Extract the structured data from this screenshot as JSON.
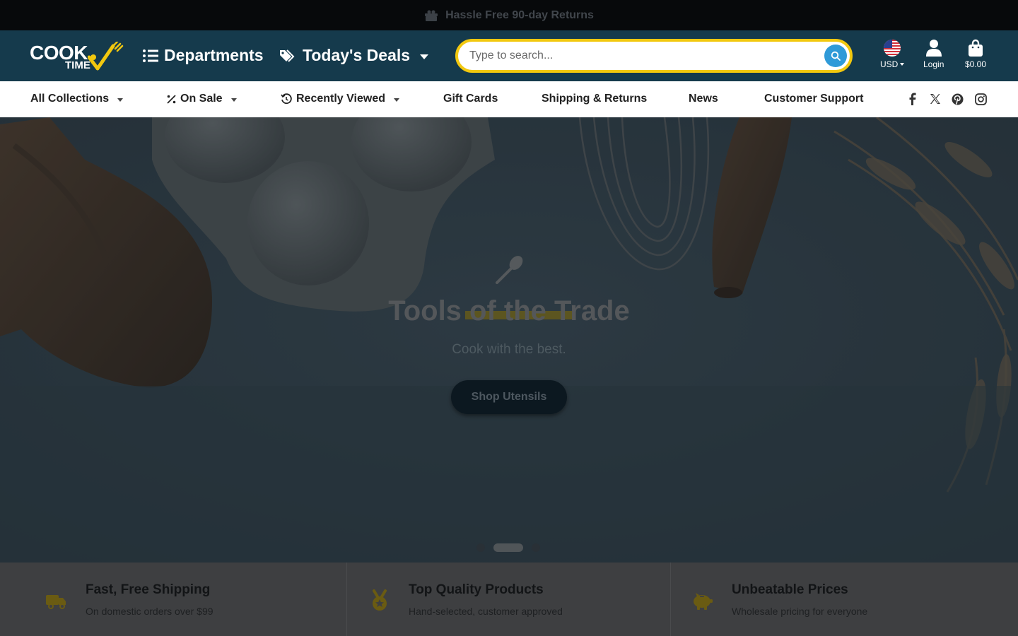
{
  "announcement": {
    "text": "Hassle Free 90-day Returns",
    "icon": "gift-box-icon"
  },
  "header": {
    "logo": {
      "word1": "COOK",
      "word2": "TIME"
    },
    "departments_label": "Departments",
    "deals_label": "Today's Deals",
    "search": {
      "placeholder": "Type to search...",
      "value": ""
    },
    "currency_label": "USD",
    "login_label": "Login",
    "cart_label": "$0.00"
  },
  "subnav": {
    "items": [
      {
        "label": "All Collections",
        "has_dropdown": true
      },
      {
        "label": "On Sale",
        "has_dropdown": true,
        "icon": "percent-icon"
      },
      {
        "label": "Recently Viewed",
        "has_dropdown": true,
        "icon": "history-icon"
      },
      {
        "label": "Gift Cards"
      },
      {
        "label": "Shipping & Returns"
      },
      {
        "label": "News"
      },
      {
        "label": "Customer Support"
      }
    ],
    "social": [
      "facebook-icon",
      "x-twitter-icon",
      "pinterest-icon",
      "instagram-icon"
    ]
  },
  "hero": {
    "title": "Tools of the Trade",
    "subtitle": "Cook with the best.",
    "button_label": "Shop Utensils",
    "slides_total": 3,
    "active_slide": 2
  },
  "features": [
    {
      "title": "Fast, Free Shipping",
      "desc": "On domestic orders over $99",
      "icon": "shipping-truck-icon"
    },
    {
      "title": "Top Quality Products",
      "desc": "Hand-selected, customer approved",
      "icon": "medal-icon"
    },
    {
      "title": "Unbeatable Prices",
      "desc": "Wholesale pricing for everyone",
      "icon": "piggy-bank-icon"
    }
  ],
  "colors": {
    "header_bg": "#153a4c",
    "accent_yellow": "#f2c80f",
    "search_button": "#2f9ad8",
    "announcement_bg": "#07090b"
  }
}
